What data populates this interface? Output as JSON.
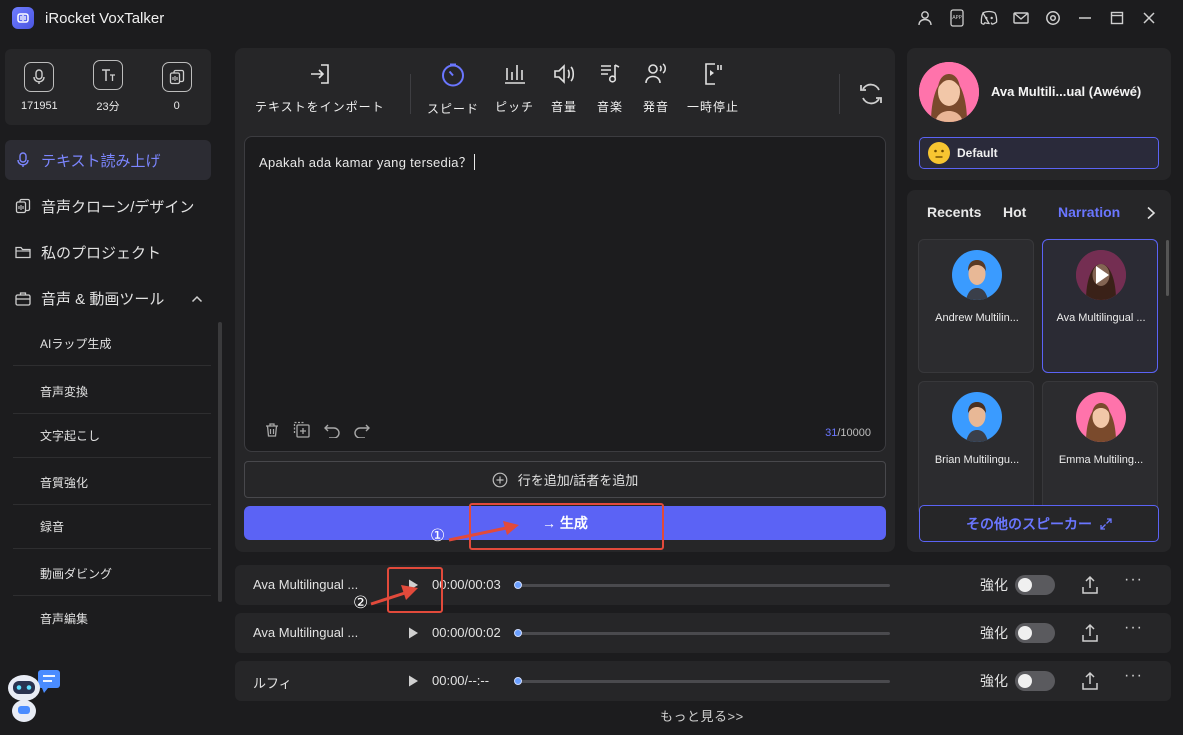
{
  "app": {
    "title": "iRocket VoxTalker"
  },
  "window_icons": [
    "user-icon",
    "app-icon",
    "discord-icon",
    "mail-icon",
    "settings-icon",
    "minimize-icon",
    "maximize-icon",
    "close-icon"
  ],
  "stats": [
    {
      "icon": "microphone-icon",
      "value": "171951"
    },
    {
      "icon": "text-icon",
      "value": "23分"
    },
    {
      "icon": "clone-icon",
      "value": "0"
    }
  ],
  "sidebar": {
    "items": [
      {
        "label": "テキスト読み上げ",
        "active": true
      },
      {
        "label": "音声クローン/デザイン"
      },
      {
        "label": "私のプロジェクト"
      },
      {
        "label": "音声 & 動画ツール"
      }
    ],
    "sub_items": [
      "AIラップ生成",
      "音声変換",
      "文字起こし",
      "音質強化",
      "録音",
      "動画ダビング",
      "音声編集"
    ]
  },
  "toolbar": {
    "import_label": "テキストをインポート",
    "speed_label": "スピード",
    "pitch_label": "ピッチ",
    "volume_label": "音量",
    "music_label": "音楽",
    "pronunciation_label": "発音",
    "pause_label": "一時停止"
  },
  "editor": {
    "text": "Apakah ada kamar yang tersedia？",
    "char_current": "31",
    "char_max": "/10000",
    "add_line_label": "行を追加/話者を追加",
    "generate_label": "→ 生成"
  },
  "annotations": {
    "one": "①",
    "two": "②",
    "color": "#e24a3b"
  },
  "voice": {
    "name": "Ava Multili...ual (Awéwé)",
    "style": "Default"
  },
  "voice_tabs": [
    "Recents",
    "Hot",
    "Narration"
  ],
  "voice_tiles": [
    {
      "name": "Andrew Multilin..."
    },
    {
      "name": "Ava Multilingual ..."
    },
    {
      "name": "Brian Multilingu..."
    },
    {
      "name": "Emma Multiling..."
    }
  ],
  "more_speakers_label": "その他のスピーカー",
  "audio_rows": [
    {
      "name": "Ava Multilingual ...",
      "time": "00:00/00:03",
      "enhance_label": "強化"
    },
    {
      "name": "Ava Multilingual ...",
      "time": "00:00/00:02",
      "enhance_label": "強化"
    },
    {
      "name": "ルフィ",
      "time": "00:00/--:--",
      "enhance_label": "強化"
    }
  ],
  "more_label": "もっと見る>>",
  "colors": {
    "accent": "#5b63f5",
    "accent_text": "#6a76ff",
    "background": "#1c1c1e",
    "panel": "#262628"
  }
}
